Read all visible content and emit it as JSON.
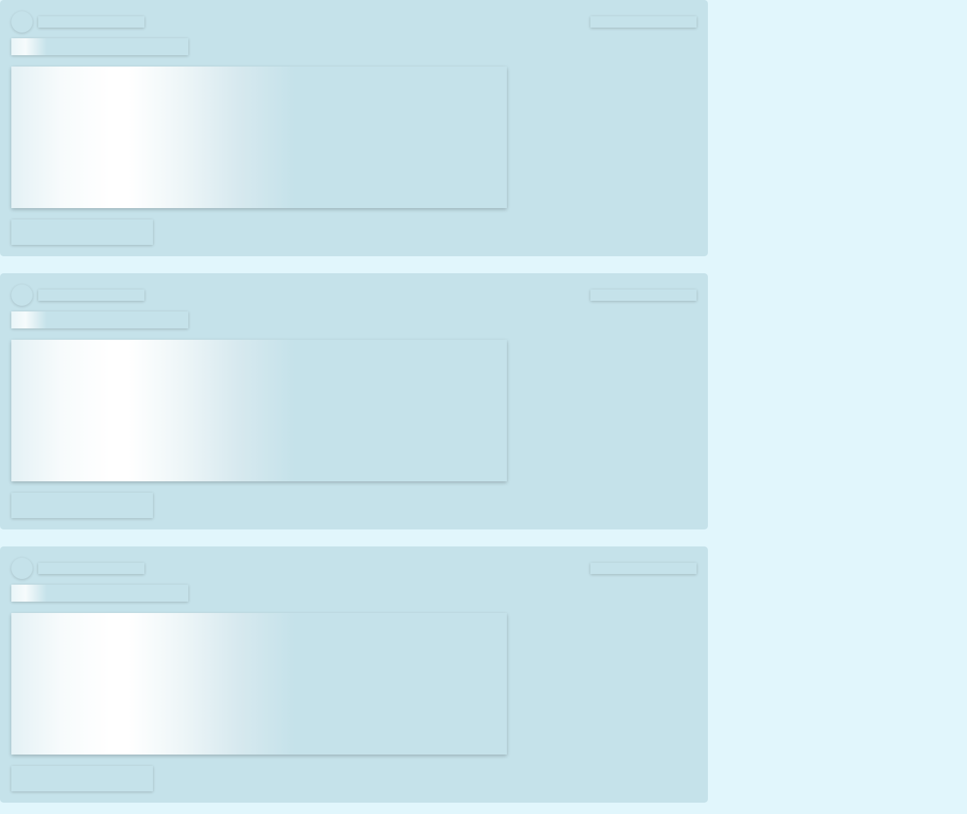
{
  "page": {
    "state": "loading",
    "background_color": "#e1f6fc",
    "card_color": "#c5e2ea",
    "shimmer_highlight_color": "#ffffff"
  },
  "feed": {
    "cards": [
      {
        "placeholders": [
          "avatar",
          "author-name",
          "timestamp",
          "title",
          "media",
          "action-button"
        ]
      },
      {
        "placeholders": [
          "avatar",
          "author-name",
          "timestamp",
          "title",
          "media",
          "action-button"
        ]
      },
      {
        "placeholders": [
          "avatar",
          "author-name",
          "timestamp",
          "title",
          "media",
          "action-button"
        ]
      }
    ]
  }
}
